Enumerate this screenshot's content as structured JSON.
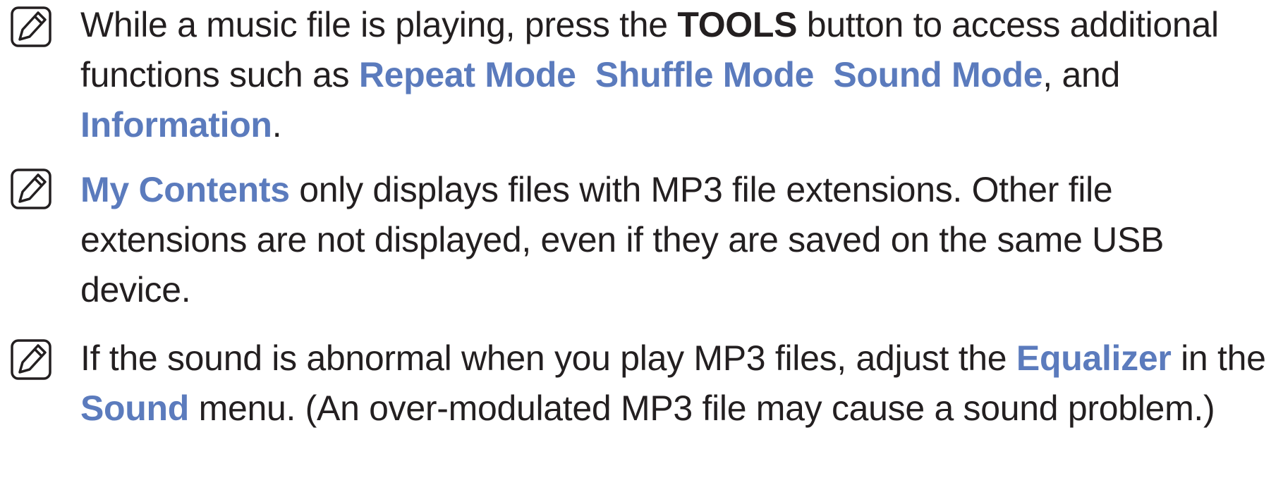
{
  "notes": [
    {
      "icon": "note-pencil-icon",
      "segments": [
        "While a music file is playing, press the ",
        "TOOLS",
        " button to access additional functions such as ",
        "Repeat Mode",
        "  ",
        "Shuffle Mode",
        "  ",
        "Sound Mode",
        ", and ",
        "Information",
        "."
      ]
    },
    {
      "icon": "note-pencil-icon",
      "segments": [
        "My Contents",
        " only displays files with MP3 file extensions. Other file extensions are not displayed, even if they are saved on the same USB device."
      ]
    },
    {
      "icon": "note-pencil-icon",
      "segments": [
        "If the sound is abnormal when you play MP3 files, adjust the ",
        "Equalizer",
        " in the ",
        "Sound",
        " menu. (An over-modulated MP3 file may cause a sound problem.)"
      ]
    }
  ],
  "colors": {
    "text": "#231f20",
    "highlight": "#5b7bbd"
  }
}
